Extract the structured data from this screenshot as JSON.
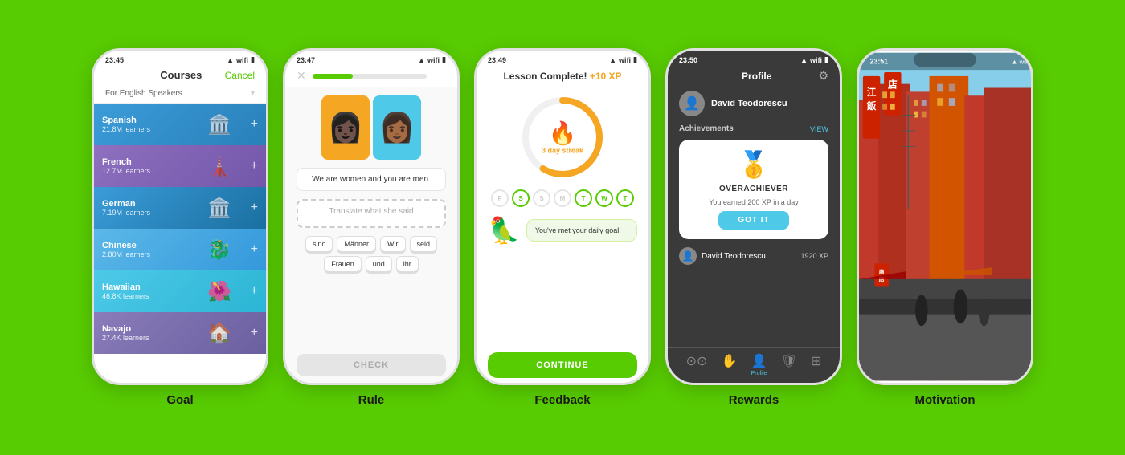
{
  "background_color": "#58cc02",
  "phones": [
    {
      "id": "goal",
      "label": "Goal",
      "time": "23:45",
      "header_title": "Courses",
      "header_cancel": "Cancel",
      "subtitle": "For English Speakers",
      "courses": [
        {
          "name": "Spanish",
          "learners": "21.8M learners",
          "color": "spanish",
          "emoji": "🏛️"
        },
        {
          "name": "French",
          "learners": "12.7M learners",
          "color": "french",
          "emoji": "🗼"
        },
        {
          "name": "German",
          "learners": "7.19M learners",
          "color": "german",
          "emoji": "🏛️"
        },
        {
          "name": "Chinese",
          "learners": "2.80M learners",
          "color": "chinese",
          "emoji": "🐉"
        },
        {
          "name": "Hawaiian",
          "learners": "46.8K learners",
          "color": "hawaiian",
          "emoji": "🌺"
        },
        {
          "name": "Navajo",
          "learners": "27.4K learners",
          "color": "navajo",
          "emoji": "🏠"
        }
      ]
    },
    {
      "id": "rule",
      "label": "Rule",
      "time": "23:47",
      "sentence": "We are women and you are men.",
      "translate_placeholder": "Translate what she said",
      "words": [
        "sind",
        "Männer",
        "Wir",
        "seid",
        "Frauen",
        "und",
        "ihr"
      ],
      "check_label": "CHECK",
      "progress": 35
    },
    {
      "id": "feedback",
      "label": "Feedback",
      "time": "23:49",
      "lesson_complete": "Lesson Complete!",
      "xp": "+10 XP",
      "streak_days": "3 day streak",
      "day_letters": [
        "F",
        "S",
        "S",
        "M",
        "T",
        "W",
        "T"
      ],
      "mascot_message": "You've met your daily goal!",
      "continue_label": "CONTINUE"
    },
    {
      "id": "rewards",
      "label": "Rewards",
      "time": "23:50",
      "profile_title": "Profile",
      "profile_name": "David Teodorescu",
      "achievements_label": "Achievements",
      "view_label": "VIEW",
      "badge_emoji": "🥇",
      "achievement_name": "OVERACHIEVER",
      "achievement_desc": "You earned 200 XP in a day",
      "got_it_label": "GOT IT",
      "leaderboard_name": "David Teodorescu",
      "leaderboard_xp": "1920 XP",
      "nav_items": [
        {
          "icon": "○○",
          "label": "",
          "active": false
        },
        {
          "icon": "🤚",
          "label": "",
          "active": false
        },
        {
          "icon": "👤",
          "label": "Profile",
          "active": true
        },
        {
          "icon": "🛡",
          "label": "",
          "active": false
        },
        {
          "icon": "⊞",
          "label": "",
          "active": false
        }
      ]
    },
    {
      "id": "motivation",
      "label": "Motivation",
      "time": "23:51",
      "chinese_text_1": "江饭",
      "chinese_text_2": "店"
    }
  ]
}
